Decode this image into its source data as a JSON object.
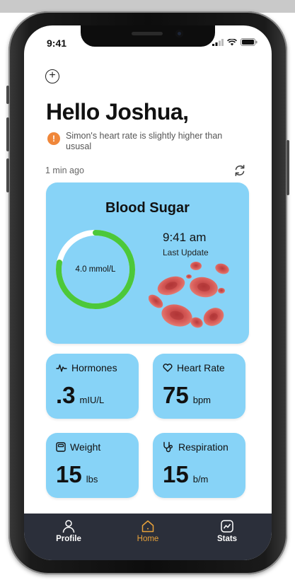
{
  "status": {
    "time": "9:41"
  },
  "greeting": "Hello Joshua,",
  "alert": {
    "icon": "alert-icon",
    "symbol": "!",
    "text": "Simon's heart rate is slightly higher than ususal",
    "color": "#f0873a"
  },
  "updated_ago": "1 min ago",
  "blood_sugar": {
    "title": "Blood Sugar",
    "value_label": "4.0 mmol/L",
    "progress": 0.78,
    "time": "9:41 am",
    "subtitle": "Last Update",
    "ring_color": "#4cc83a"
  },
  "metrics": [
    {
      "title": "Hormones",
      "icon": "pulse-icon",
      "value": ".3",
      "unit": "mIU/L"
    },
    {
      "title": "Heart Rate",
      "icon": "heart-icon",
      "value": "75",
      "unit": "bpm"
    },
    {
      "title": "Weight",
      "icon": "scale-icon",
      "value": "15",
      "unit": "lbs"
    },
    {
      "title": "Respiration",
      "icon": "stethoscope-icon",
      "value": "15",
      "unit": "b/m"
    }
  ],
  "nav": [
    {
      "label": "Profile",
      "icon": "profile-icon"
    },
    {
      "label": "Home",
      "icon": "home-icon",
      "active": true
    },
    {
      "label": "Stats",
      "icon": "stats-icon"
    }
  ],
  "colors": {
    "card": "#87d3f7",
    "nav_bg": "#2b2f3a",
    "active": "#e8a23a"
  }
}
